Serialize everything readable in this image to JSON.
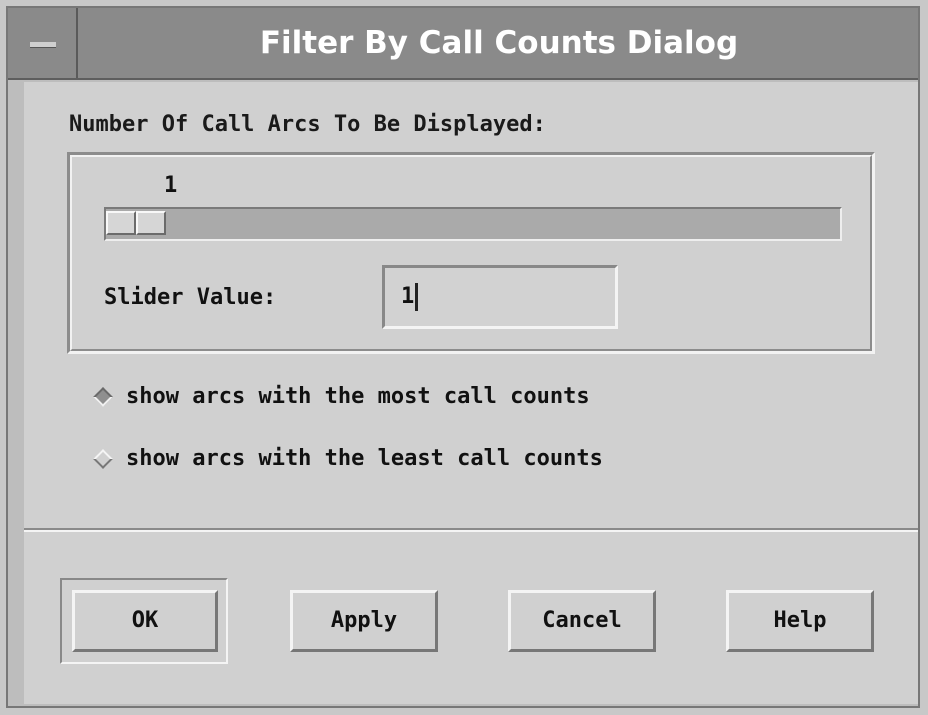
{
  "window": {
    "title": "Filter By Call Counts Dialog"
  },
  "filter": {
    "section_label": "Number Of Call Arcs To Be Displayed:",
    "slider_display": "1",
    "slider_value_label": "Slider Value:",
    "slider_value": "1",
    "slider_fraction": 0.0
  },
  "options": [
    {
      "label": "show arcs with the most call counts",
      "selected": true
    },
    {
      "label": "show arcs with the least call counts",
      "selected": false
    }
  ],
  "buttons": {
    "ok": "OK",
    "apply": "Apply",
    "cancel": "Cancel",
    "help": "Help"
  },
  "icons": {
    "window_menu": "window-menu-icon",
    "radio": "diamond-radio-icon"
  }
}
